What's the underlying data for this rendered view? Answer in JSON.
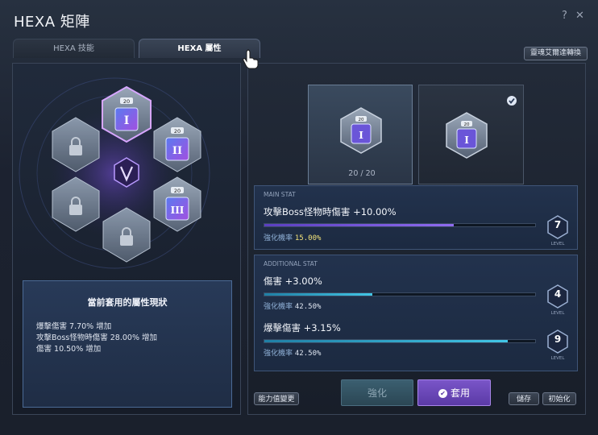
{
  "window": {
    "title": "HEXA 矩陣"
  },
  "titlebar": {
    "help_label": "?",
    "close_label": "✕"
  },
  "tabs": [
    {
      "label": "HEXA 技能",
      "active": false
    },
    {
      "label": "HEXA 屬性",
      "active": true
    }
  ],
  "convert_button": "靈魂艾爾達轉換",
  "hexa_grid": {
    "cores": [
      {
        "state": "unlocked",
        "level": "20",
        "numeral": "I",
        "selected": true
      },
      {
        "state": "unlocked",
        "level": "20",
        "numeral": "II",
        "selected": false
      },
      {
        "state": "unlocked",
        "level": "20",
        "numeral": "III",
        "selected": false
      },
      {
        "state": "locked",
        "icon": "lock-icon"
      },
      {
        "state": "locked",
        "icon": "lock-icon"
      },
      {
        "state": "locked",
        "icon": "lock-icon"
      }
    ],
    "center_icon": "v-emblem-icon"
  },
  "status_panel": {
    "title": "當前套用的屬性現狀",
    "lines": [
      "爆擊傷害 7.70% 增加",
      "攻擊Boss怪物時傷害 28.00% 增加",
      "傷害 10.50% 增加"
    ]
  },
  "preview": {
    "left_slot": {
      "level": "20",
      "numeral": "I"
    },
    "right_slot": {
      "level": "20",
      "numeral": "I",
      "checked": true
    },
    "count": "20 / 20"
  },
  "main_stat": {
    "section_label": "MAIN STAT",
    "name": "攻擊Boss怪物時傷害 +10.00%",
    "prob_label": "強化機率",
    "prob_value": "15.00%",
    "level": "7",
    "level_label": "LEVEL",
    "progress": 0.7
  },
  "additional_stat": {
    "section_label": "ADDITIONAL STAT",
    "items": [
      {
        "name": "傷害 +3.00%",
        "prob_label": "強化機率",
        "prob_value": "42.50%",
        "level": "4",
        "level_label": "LEVEL",
        "progress": 0.4
      },
      {
        "name": "爆擊傷害 +3.15%",
        "prob_label": "強化機率",
        "prob_value": "42.50%",
        "level": "9",
        "level_label": "LEVEL",
        "progress": 0.9
      }
    ]
  },
  "buttons": {
    "ability_change": "能力值變更",
    "reinforce": "強化",
    "apply": "套用",
    "save": "儲存",
    "reset": "初始化"
  },
  "colors": {
    "accent_purple": "#7a55c8",
    "bar_main": "#7b5ee0",
    "bar_additional": "#2fb8d8"
  }
}
